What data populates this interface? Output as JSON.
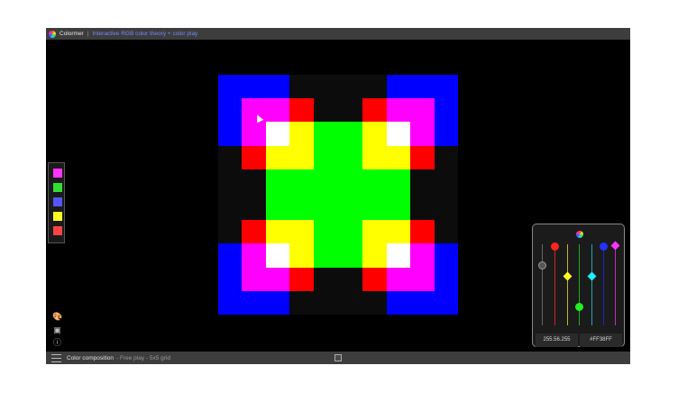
{
  "app": {
    "name": "Colormer",
    "subtitle": "Interactive RGB color theory + color play"
  },
  "icons": {
    "app_logo": "color-wheel-icon",
    "palette_tool": "palette-icon",
    "image_tool": "image-icon",
    "info_tool": "info-icon",
    "menu": "hamburger-menu-icon",
    "grid_tool": "grid-icon"
  },
  "colors": {
    "blue": "#0000ff",
    "magenta": "#ff00ff",
    "red": "#ff0000",
    "white": "#ffffff",
    "yellow": "#ffff00",
    "green": "#00ff00",
    "background": "#000000",
    "empty": "#0c0c0c"
  },
  "palette": [
    "#ff33ff",
    "#33dd33",
    "#5555ff",
    "#ffff22",
    "#ff4444"
  ],
  "mixer": {
    "left_value": "255.56.255",
    "right_value": "#FF38FF"
  },
  "status": {
    "title": "Color composition",
    "subtitle": "- Free play - 5x5 grid"
  }
}
